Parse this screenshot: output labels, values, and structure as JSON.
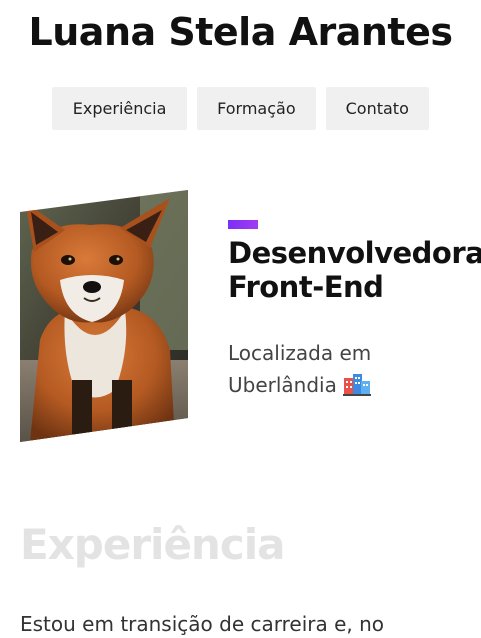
{
  "header": {
    "title": "Luana Stela Arantes"
  },
  "nav": {
    "items": [
      {
        "label": "Experiência"
      },
      {
        "label": "Formação"
      },
      {
        "label": "Contato"
      }
    ]
  },
  "hero": {
    "photo_icon": "fox-photo",
    "accent_color": "#7b2ff7",
    "role": "Desenvolvedora Front-End",
    "location_text": "Localizada em Uberlândia",
    "location_icon": "city-buildings-icon"
  },
  "experience": {
    "title": "Experiência",
    "text": "Estou em transição de carreira e, no"
  }
}
